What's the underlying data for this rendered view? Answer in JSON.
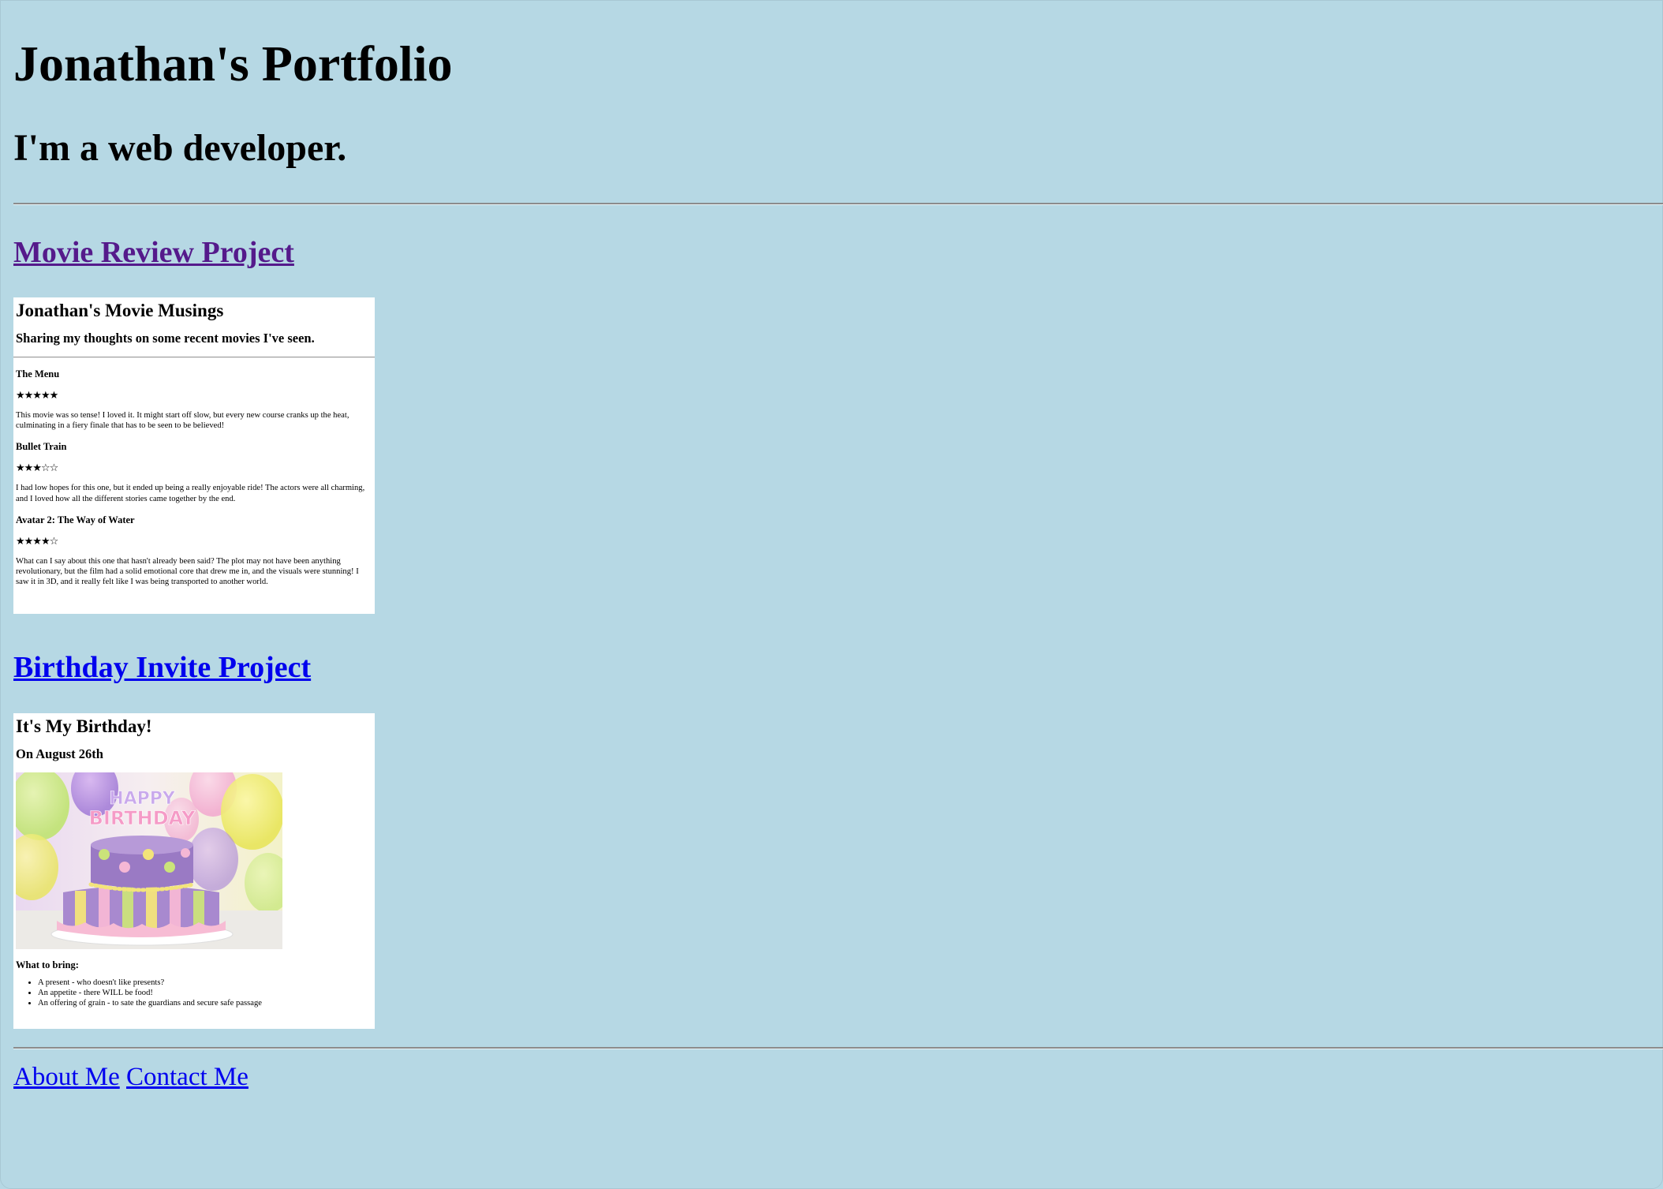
{
  "header": {
    "title": "Jonathan's Portfolio",
    "tagline": "I'm a web developer."
  },
  "projects": [
    {
      "link_label": "Movie Review Project",
      "visited": true,
      "preview": {
        "title": "Jonathan's Movie Musings",
        "subtitle": "Sharing my thoughts on some recent movies I've seen.",
        "reviews": [
          {
            "movie": "The Menu",
            "stars": "★★★★★",
            "rating": 5,
            "text": "This movie was so tense! I loved it. It might start off slow, but every new course cranks up the heat, culminating in a fiery finale that has to be seen to be believed!"
          },
          {
            "movie": "Bullet Train",
            "stars": "★★★☆☆",
            "rating": 3,
            "text": "I had low hopes for this one, but it ended up being a really enjoyable ride! The actors were all charming, and I loved how all the different stories came together by the end."
          },
          {
            "movie": "Avatar 2: The Way of Water",
            "stars": "★★★★☆",
            "rating": 4,
            "text": "What can I say about this one that hasn't already been said? The plot may not have been anything revolutionary, but the film had a solid emotional core that drew me in, and the visuals were stunning! I saw it in 3D, and it really felt like I was being transported to another world."
          }
        ]
      }
    },
    {
      "link_label": "Birthday Invite Project",
      "visited": false,
      "preview": {
        "title": "It's My Birthday!",
        "date": "On August 26th",
        "image_text": "HAPPY BIRTHDAY",
        "bring_heading": "What to bring:",
        "bring_items": [
          "A present - who doesn't like presents?",
          "An appetite - there WILL be food!",
          "An offering of grain - to sate the guardians and secure safe passage"
        ]
      }
    }
  ],
  "footer": {
    "about_label": "About Me",
    "contact_label": "Contact Me"
  },
  "colors": {
    "page_background": "#b6d8e4",
    "visited_link": "#551a8b",
    "link": "#0000ee",
    "preview_background": "#ffffff"
  }
}
